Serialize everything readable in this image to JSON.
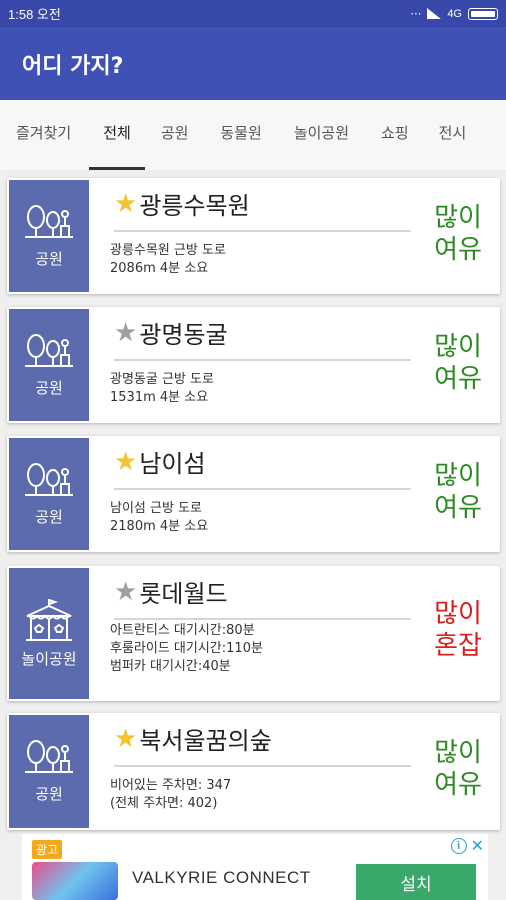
{
  "status_bar": {
    "time": "1:58 오전",
    "network": "4G"
  },
  "app_bar": {
    "title": "어디 가지?"
  },
  "tabs": [
    {
      "label": "즐겨찾기",
      "active": false
    },
    {
      "label": "전체",
      "active": true
    },
    {
      "label": "공원",
      "active": false
    },
    {
      "label": "동물원",
      "active": false
    },
    {
      "label": "놀이공원",
      "active": false
    },
    {
      "label": "쇼핑",
      "active": false
    },
    {
      "label": "전시",
      "active": false
    }
  ],
  "places": [
    {
      "category": "공원",
      "category_icon": "tree-icon",
      "favorite": true,
      "name": "광릉수목원",
      "lines": [
        "광릉수목원 근방 도로",
        "2086m 4분 소요"
      ],
      "status": [
        "많이",
        "여유"
      ],
      "status_type": "ok"
    },
    {
      "category": "공원",
      "category_icon": "tree-icon",
      "favorite": false,
      "name": "광명동굴",
      "lines": [
        "광명동굴 근방 도로",
        "1531m 4분 소요"
      ],
      "status": [
        "많이",
        "여유"
      ],
      "status_type": "ok"
    },
    {
      "category": "공원",
      "category_icon": "tree-icon",
      "favorite": true,
      "name": "남이섬",
      "lines": [
        "남이섬 근방 도로",
        "2180m 4분 소요"
      ],
      "status": [
        "많이",
        "여유"
      ],
      "status_type": "ok"
    },
    {
      "category": "놀이공원",
      "category_icon": "carousel-icon",
      "favorite": false,
      "name": "롯데월드",
      "lines": [
        "아트란티스 대기시간:80분",
        "후룸라이드 대기시간:110분",
        "범퍼카 대기시간:40분"
      ],
      "status": [
        "많이",
        "혼잡"
      ],
      "status_type": "busy"
    },
    {
      "category": "공원",
      "category_icon": "tree-icon",
      "favorite": true,
      "name": "북서울꿈의숲",
      "lines": [
        "비어있는 주차면: 347",
        "(전체 주차면: 402)"
      ],
      "status": [
        "많이",
        "여유"
      ],
      "status_type": "ok"
    }
  ],
  "ad": {
    "tag": "광고",
    "title": "VALKYRIE CONNECT",
    "button": "설치"
  },
  "colors": {
    "app_bar": "#3f51b5",
    "category_tile": "#5c6bad",
    "ok": "#2e8b24",
    "busy": "#d82020",
    "star": "#f4c430"
  }
}
